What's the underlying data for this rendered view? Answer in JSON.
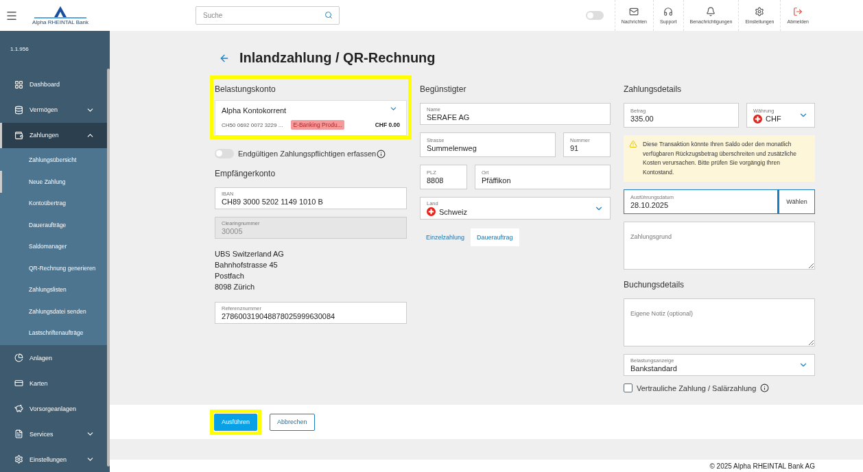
{
  "header": {
    "logo_text": "Alpha RHEINTAL Bank",
    "search_placeholder": "Suche",
    "toggle_on": false,
    "actions": [
      {
        "label": "Nachrichten",
        "kind": "default"
      },
      {
        "label": "Support",
        "kind": "default"
      },
      {
        "label": "Benachrichtigungen",
        "kind": "default"
      },
      {
        "label": "Einstellungen",
        "kind": "default"
      },
      {
        "label": "Abmelden",
        "kind": "danger"
      }
    ]
  },
  "sidebar": {
    "version": "1.1.956",
    "items": [
      {
        "label": "Dashboard",
        "selected": false
      },
      {
        "label": "Vermögen",
        "selected": false,
        "expanded": false
      },
      {
        "label": "Zahlungen",
        "selected": true,
        "expanded": true,
        "children": [
          {
            "label": "Zahlungsübersicht",
            "selected": false
          },
          {
            "label": "Neue Zahlung",
            "selected": true
          },
          {
            "label": "Kontoübertrag",
            "selected": false
          },
          {
            "label": "Daueraufträge",
            "selected": false
          },
          {
            "label": "Saldomanager",
            "selected": false
          },
          {
            "label": "QR-Rechnung generieren",
            "selected": false
          },
          {
            "label": "Zahlungslisten",
            "selected": false
          },
          {
            "label": "Zahlungsdatei senden",
            "selected": false
          },
          {
            "label": "Lastschriftenaufträge",
            "selected": false
          }
        ]
      },
      {
        "label": "Anlagen",
        "selected": false
      },
      {
        "label": "Karten",
        "selected": false
      },
      {
        "label": "Vorsorgeanlagen",
        "selected": false
      },
      {
        "label": "Services",
        "selected": false,
        "expanded": false
      },
      {
        "label": "Einstellungen",
        "selected": false,
        "expanded": false
      }
    ]
  },
  "page": {
    "title": "Inlandzahlung / QR-Rechnung"
  },
  "debit": {
    "heading": "Belastungskonto",
    "highlighted": true,
    "account_name": "Alpha Kontokorrent",
    "iban": "CH50 0692 0072 3229 ...",
    "tag": "E-Banking Produ...",
    "balance": "CHF 0.00"
  },
  "final_payer_toggle": {
    "label": "Endgültigen Zahlungspflichtigen erfassen",
    "on": false
  },
  "recipient_account": {
    "heading": "Empfängerkonto",
    "iban": {
      "label": "IBAN",
      "value": "CH89 3000 5202 1149 1010 B"
    },
    "clearing": {
      "label": "Clearingnummer",
      "value": "30005",
      "disabled": true
    },
    "bank_address": [
      "UBS Switzerland AG",
      "Bahnhofstrasse 45",
      "Postfach",
      "8098 Zürich"
    ],
    "reference": {
      "label": "Referenznummer",
      "value": "278600319048878025999630084"
    }
  },
  "beneficiary": {
    "heading": "Begünstigter",
    "name": {
      "label": "Name",
      "value": "SERAFE AG"
    },
    "street": {
      "label": "Strasse",
      "value": "Summelenweg"
    },
    "number": {
      "label": "Nummer",
      "value": "91"
    },
    "zip": {
      "label": "PLZ",
      "value": "8808"
    },
    "city": {
      "label": "Ort",
      "value": "Pfäffikon"
    },
    "country": {
      "label": "Land",
      "value": "Schweiz"
    },
    "payment_types": [
      {
        "label": "Einzelzahlung",
        "selected": false
      },
      {
        "label": "Dauerauftrag",
        "selected": true
      }
    ]
  },
  "details": {
    "heading": "Zahlungsdetails",
    "amount": {
      "label": "Betrag",
      "value": "335.00"
    },
    "currency": {
      "label": "Währung",
      "value": "CHF"
    },
    "warning": "Diese Transaktion könnte Ihren Saldo oder den monatlich verfügbaren Rückzugsbetrag überschreiten und zusätzliche Kosten verursachen. Bitte prüfen Sie vorgängig Ihren Kontostand.",
    "date": {
      "label": "Ausführungsdatum",
      "value": "28.10.2025",
      "focused": true
    },
    "choose_button": "Wählen",
    "reason_placeholder": "Zahlungsgrund"
  },
  "booking": {
    "heading": "Buchungsdetails",
    "note_placeholder": "Eigene Notiz (optional)",
    "debit_display": {
      "label": "Belastungsanzeige",
      "value": "Bankstandard"
    },
    "confidential": {
      "label": "Vertrauliche Zahlung / Salärzahlung",
      "checked": false
    }
  },
  "buttons": [
    {
      "label": "Ausführen",
      "kind": "primary",
      "highlighted": true
    },
    {
      "label": "Abbrechen",
      "kind": "secondary",
      "highlighted": false
    }
  ],
  "footer": {
    "copyright": "© 2025 Alpha RHEINTAL Bank AG"
  }
}
